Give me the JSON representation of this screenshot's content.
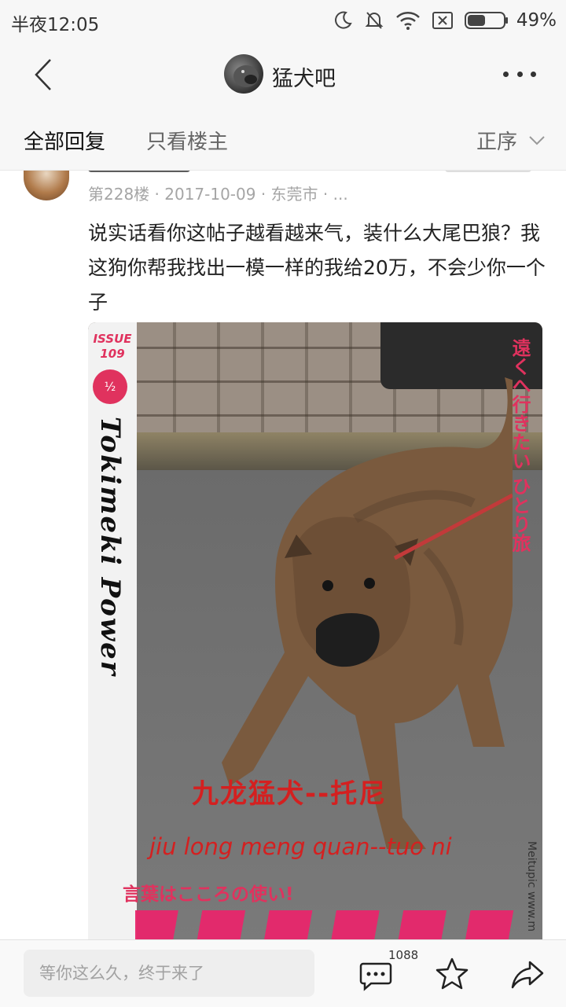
{
  "status_bar": {
    "time": "半夜12:05",
    "battery_percent": "49%"
  },
  "nav": {
    "forum_title": "猛犬吧"
  },
  "tabs": {
    "all_replies": "全部回复",
    "owner_only": "只看楼主",
    "sort_label": "正序"
  },
  "post": {
    "floor_meta": "第228楼 · 2017-10-09 · 东莞市 · ...",
    "text": "说实话看你这帖子越看越来气，装什么大尾巴狼？我这狗你帮我找出一模一样的我给20万，不会少你一个子"
  },
  "photo": {
    "issue_label": "ISSUE 109",
    "badge_text": "½",
    "vertical_title": "Tokimeki Power",
    "jp_vertical": "遠くへ行きたい ひとり旅",
    "caption_cn": "九龙猛犬--托尼",
    "caption_pinyin": "jiu long meng quan--tuo ni",
    "caption_jp": "言葉はこころの使い!",
    "watermark": "Meitupic www.m"
  },
  "bottom_bar": {
    "reply_placeholder": "等你这么久，终于来了",
    "comment_count": "1088"
  },
  "colors": {
    "accent_pink": "#e0325e",
    "caption_red": "#d42020"
  }
}
